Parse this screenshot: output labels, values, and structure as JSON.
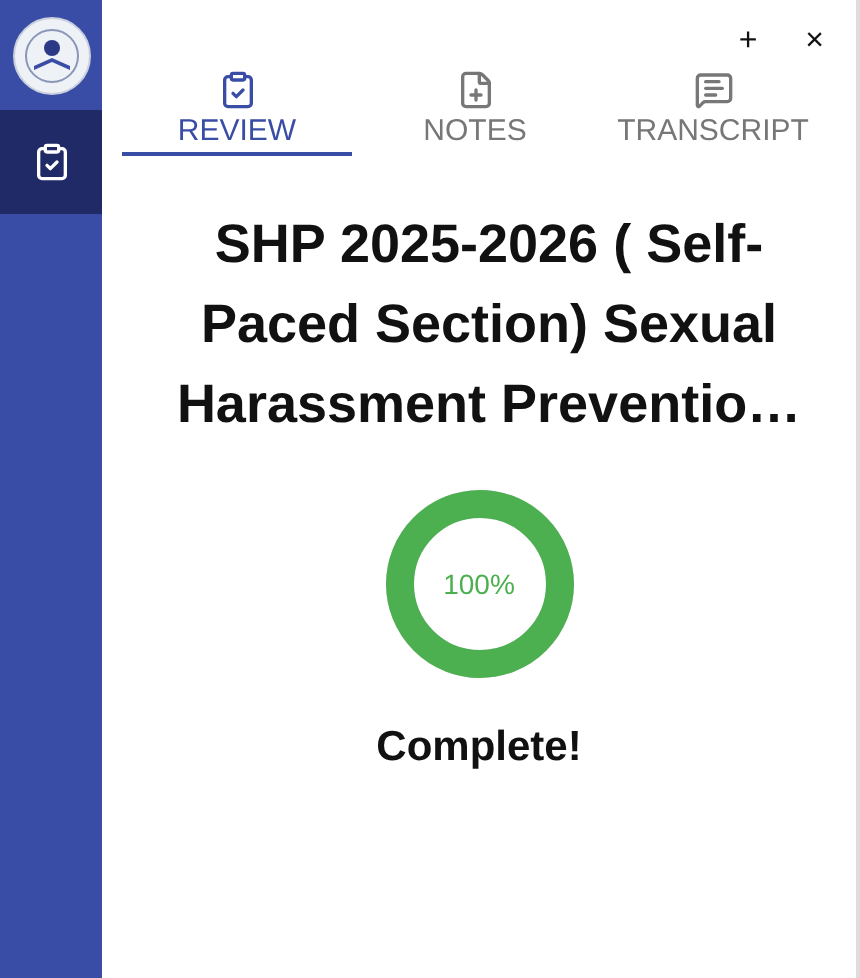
{
  "window_controls": [
    "+",
    "×"
  ],
  "sidebar": {
    "items": [
      {
        "kind": "review",
        "selected": true
      }
    ]
  },
  "tabs": [
    {
      "label": "REVIEW",
      "kind": "review",
      "selected": true
    },
    {
      "label": "NOTES",
      "kind": "notes",
      "selected": false
    },
    {
      "label": "TRANSCRIPT",
      "kind": "transcript",
      "selected": false
    }
  ],
  "course_title": "SHP 2025-2026 ( Self-Paced Section) Sexual Harassment Preventio…",
  "progress": {
    "level": 1,
    "reading": "100%"
  },
  "status": "Complete!"
}
